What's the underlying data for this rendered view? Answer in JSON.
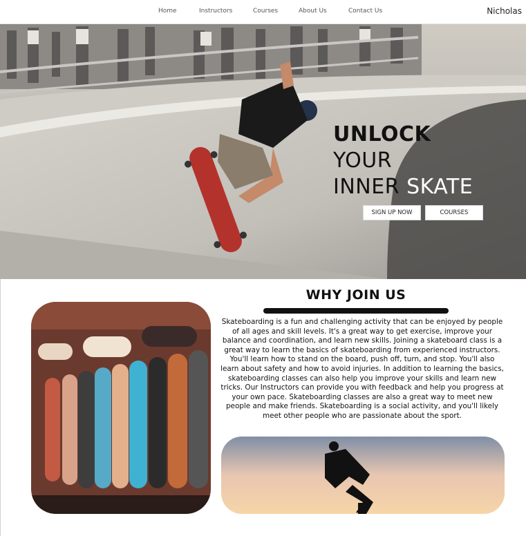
{
  "nav": {
    "links": [
      "Home",
      "Instructors",
      "Courses",
      "About Us",
      "Contact Us"
    ],
    "user": "Nicholas"
  },
  "hero": {
    "line1": "UNLOCK",
    "line2": "YOUR",
    "line3_dark": "INNER",
    "line3_light": "SKATE",
    "buttons": [
      "SIGN UP NOW",
      "COURSES"
    ]
  },
  "why": {
    "title": "WHY JOIN US",
    "body": "Skateboarding is a fun and challenging activity that can be enjoyed by people of all ages and skill levels. It's a great way to get exercise, improve your balance and coordination, and learn new skills. Joining a skateboard class is a great way to learn the basics of skateboarding from experienced instructors. You'll learn how to stand on the board, push off, turn, and stop. You'll also learn about safety and how to avoid injuries. In addition to learning the basics, skateboarding classes can also help you improve your skills and learn new tricks. Our Instructors can provide you with feedback and help you progress at your own pace. Skateboarding classes are also a great way to meet new people and make friends. Skateboarding is a social activity, and you'll likely meet other people who are passionate about the sport."
  },
  "colors": {
    "accent": "#111111",
    "hero_bg": "#b7b5b0",
    "sunset_top": "#7f8fa6",
    "sunset_bottom": "#f6d5a8"
  }
}
